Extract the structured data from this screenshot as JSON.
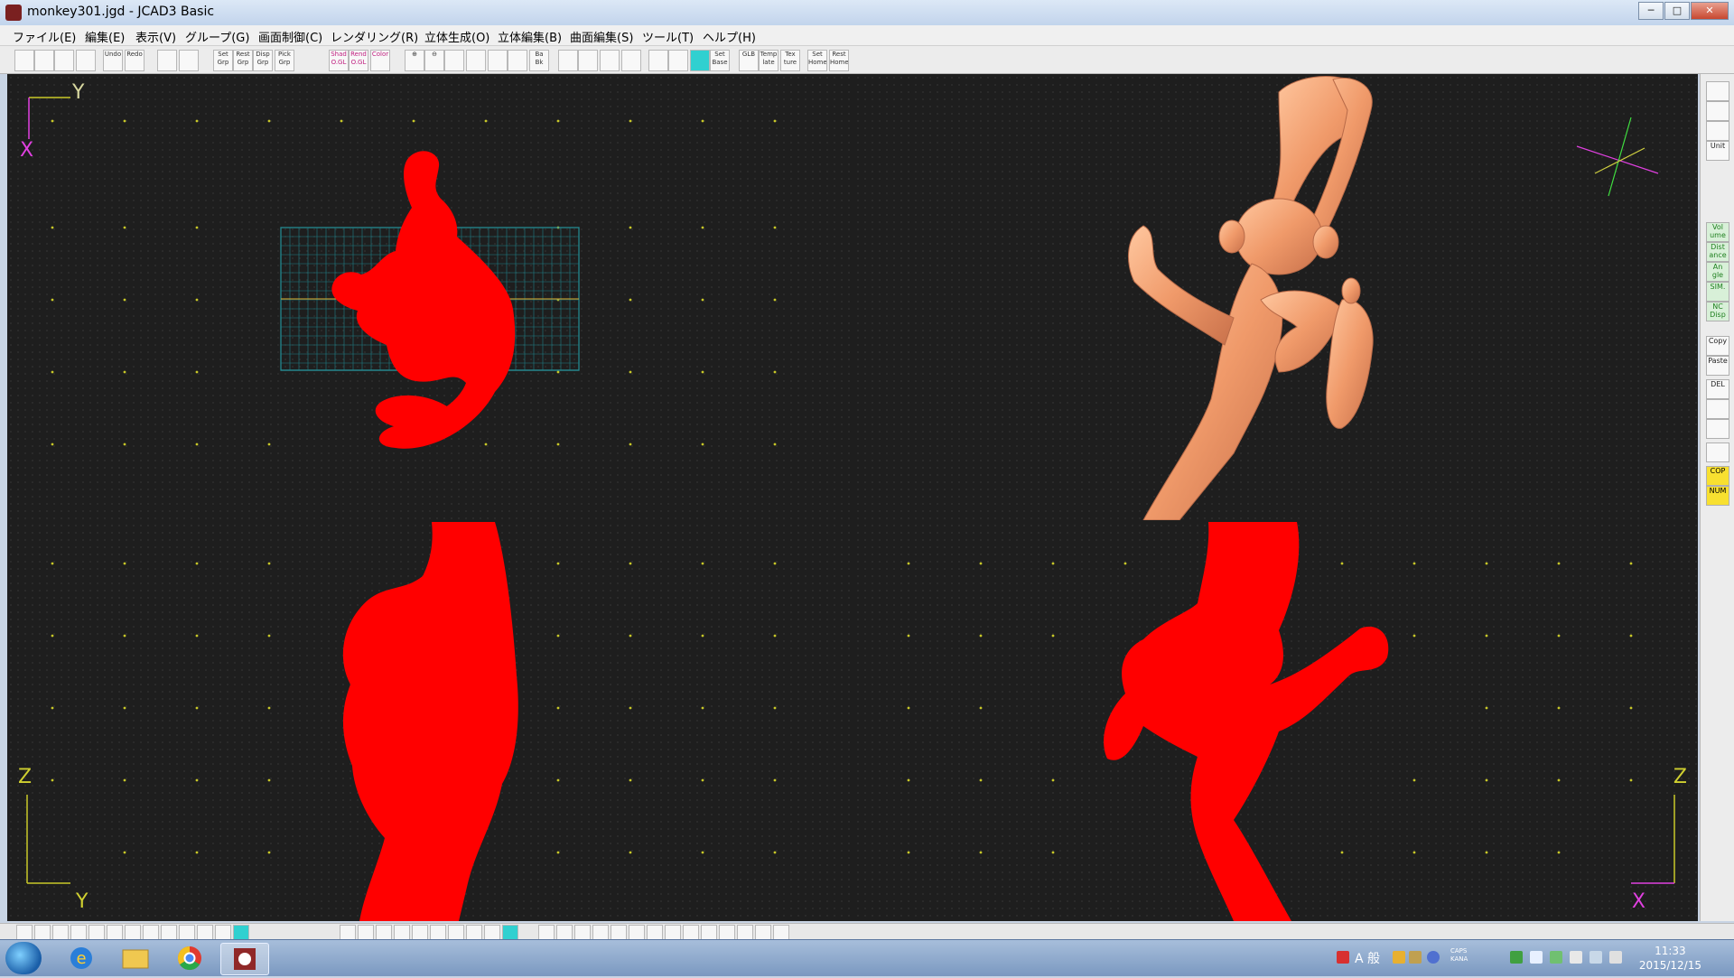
{
  "window": {
    "title": "monkey301.jgd - JCAD3 Basic",
    "controls": [
      "─",
      "□",
      "✕"
    ]
  },
  "menu": [
    "ファイル(E)",
    "編集(E)",
    "表示(V)",
    "グループ(G)",
    "画面制御(C)",
    "レンダリング(R)",
    "立体生成(O)",
    "立体編集(B)",
    "曲面編集(S)",
    "ツール(T)",
    "ヘルプ(H)"
  ],
  "toolbar": {
    "groups": [
      [
        "new",
        "open",
        "save",
        "print"
      ],
      [
        "Undo",
        "Redo"
      ],
      [
        "frame",
        "grid"
      ],
      [
        "Set Grp",
        "Rest Grp",
        "Disp Grp",
        "Pick Grp"
      ],
      [
        "Shad O.GL",
        "Rend O.GL",
        "Color"
      ],
      [
        "zoom-in",
        "zoom-out",
        "fit",
        "win",
        "win2",
        "pan",
        "Ba Bk"
      ],
      [
        "z1",
        "z2",
        "z3",
        "z4"
      ],
      [
        "grid1",
        "grid2",
        "grid3",
        "Set Base"
      ],
      [
        "GLB",
        "Temp late",
        "Tex ture"
      ],
      [
        "Set Home",
        "Rest Home"
      ]
    ]
  },
  "viewports": {
    "top": {
      "axis_h": "Y",
      "axis_v": "X"
    },
    "front": {
      "axis_v": "Z",
      "axis_h": "Y"
    },
    "side": {
      "axis_v": "Z",
      "axis_h": "X"
    }
  },
  "sidebar": {
    "top_buttons": [
      "",
      "",
      "",
      "Unit"
    ],
    "measure_buttons": [
      "Vol ume",
      "Dist ance",
      "An gle",
      "SIM.",
      "NC Disp"
    ],
    "edit_buttons": [
      "Copy",
      "Paste",
      "DEL",
      "",
      "",
      ""
    ],
    "mode_buttons": [
      "COP",
      "NUM"
    ]
  },
  "taskbar": {
    "apps": [
      "internet-explorer",
      "file-explorer",
      "chrome",
      "jcad3"
    ],
    "tray_text": "A 般",
    "caps": "CAPS KANA",
    "time": "11:33",
    "date": "2015/12/15"
  },
  "colors": {
    "model_red": "#ff0000",
    "model_shaded": "#f0a070",
    "grid_cyan": "#28a0a8",
    "grid_dot_yellow": "#c8c828",
    "axis_magenta": "#e040e0",
    "axis_green": "#40e040"
  }
}
